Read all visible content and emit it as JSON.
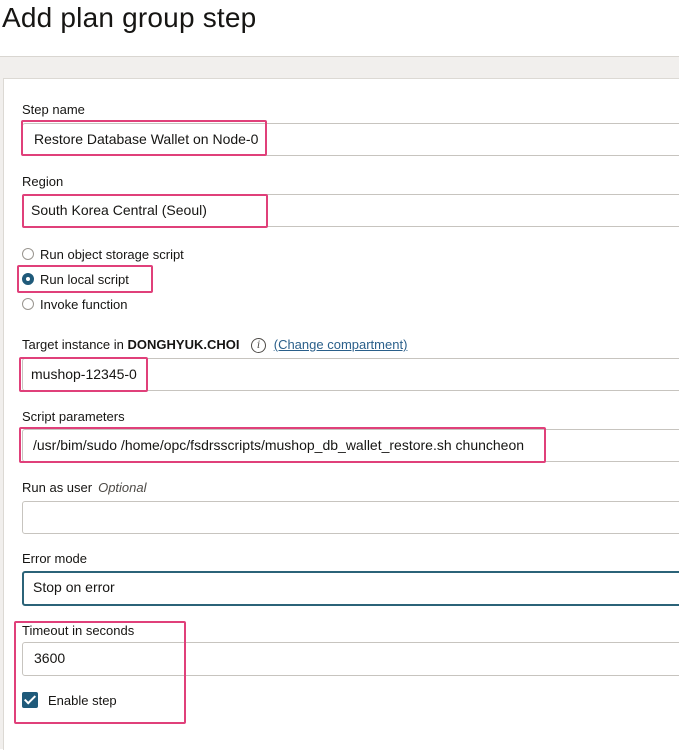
{
  "page": {
    "title": "Add plan group step"
  },
  "form": {
    "step_name": {
      "label": "Step name",
      "value": "Restore Database Wallet on Node-0"
    },
    "region": {
      "label": "Region",
      "value": "South Korea Central (Seoul)"
    },
    "script_type": {
      "options": [
        {
          "label": "Run object storage script",
          "selected": false
        },
        {
          "label": "Run local script",
          "selected": true
        },
        {
          "label": "Invoke function",
          "selected": false
        }
      ]
    },
    "target_instance": {
      "label_prefix": "Target instance in",
      "compartment": "DONGHYUK.CHOI",
      "info_glyph": "i",
      "change_link": "(Change compartment)",
      "value": "mushop-12345-0"
    },
    "script_parameters": {
      "label": "Script parameters",
      "value": "/usr/bim/sudo /home/opc/fsdrsscripts/mushop_db_wallet_restore.sh chuncheon"
    },
    "run_as_user": {
      "label": "Run as user",
      "optional": "Optional",
      "value": ""
    },
    "error_mode": {
      "label": "Error mode",
      "value": "Stop on error"
    },
    "timeout": {
      "label": "Timeout in seconds",
      "value": "3600"
    },
    "enable_step": {
      "label": "Enable step",
      "checked": true
    }
  },
  "colors": {
    "highlight": "#e0407a",
    "accent": "#1f5a7a",
    "link": "#2a5f8a"
  },
  "icons": [
    "info-icon",
    "checkmark-icon",
    "radio-selected-icon",
    "radio-empty-icon"
  ]
}
